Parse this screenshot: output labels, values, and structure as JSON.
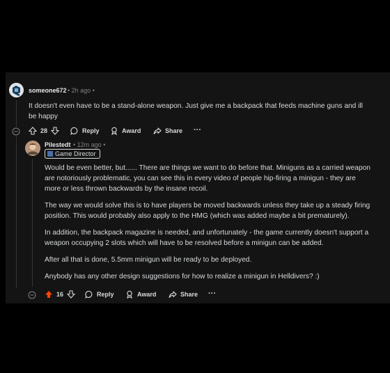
{
  "comment1": {
    "username": "someone672",
    "time": "2h ago",
    "body": "It doesn't even have to be a stand-alone weapon. Just give me a backpack that feeds machine guns and ill be happy",
    "votes": "28",
    "reply_label": "Reply",
    "award_label": "Award",
    "share_label": "Share",
    "more_label": "···"
  },
  "comment2": {
    "username": "Pilestedt",
    "time": "12m ago",
    "flair": "Game Director",
    "paragraphs": [
      "Would be even better, but...... There are things we want to do before that. Miniguns as a carried weapon are notoriously problematic, you can see this in every video of people hip-firing a minigun - they are more or less thrown backwards by the insane recoil.",
      "The way we would solve this is to have players be moved backwards unless they take up a steady firing position. This would probably also apply to the HMG (which was added maybe a bit prematurely).",
      "In addition, the backpack magazine is needed, and unfortunately - the game currently doesn't support a weapon occupying 2 slots which will have to be resolved before a minigun can be added.",
      "After all that is done, 5.5mm minigun will be ready to be deployed.",
      "Anybody has any other design suggestions for how to realize a minigun in Helldivers? :)"
    ],
    "votes": "16",
    "reply_label": "Reply",
    "award_label": "Award",
    "share_label": "Share",
    "more_label": "···"
  },
  "colors": {
    "upvote_active": "#ff4500",
    "background": "#141414"
  }
}
